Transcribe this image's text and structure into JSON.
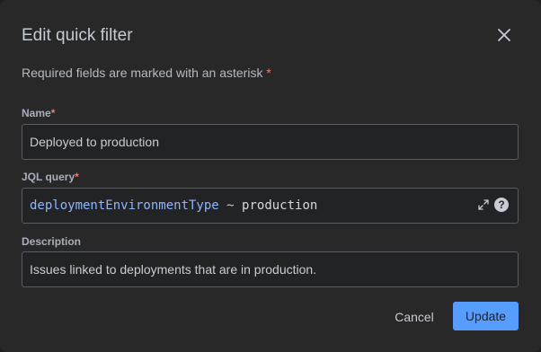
{
  "dialog": {
    "title": "Edit quick filter",
    "required_note": "Required fields are marked with an asterisk",
    "asterisk": "*"
  },
  "fields": {
    "name": {
      "label": "Name",
      "value": "Deployed to production"
    },
    "jql": {
      "label": "JQL query",
      "query_field": "deploymentEnvironmentType",
      "query_operator": "~",
      "query_value": "production",
      "expand_icon": "expand-icon",
      "help_icon": "help-icon",
      "help_glyph": "?"
    },
    "description": {
      "label": "Description",
      "value": "Issues linked to deployments that are in production."
    }
  },
  "actions": {
    "cancel_label": "Cancel",
    "update_label": "Update"
  },
  "colors": {
    "background": "#282828",
    "accent": "#579dff",
    "required": "#f2776d",
    "jql_field": "#8fb5ff"
  }
}
